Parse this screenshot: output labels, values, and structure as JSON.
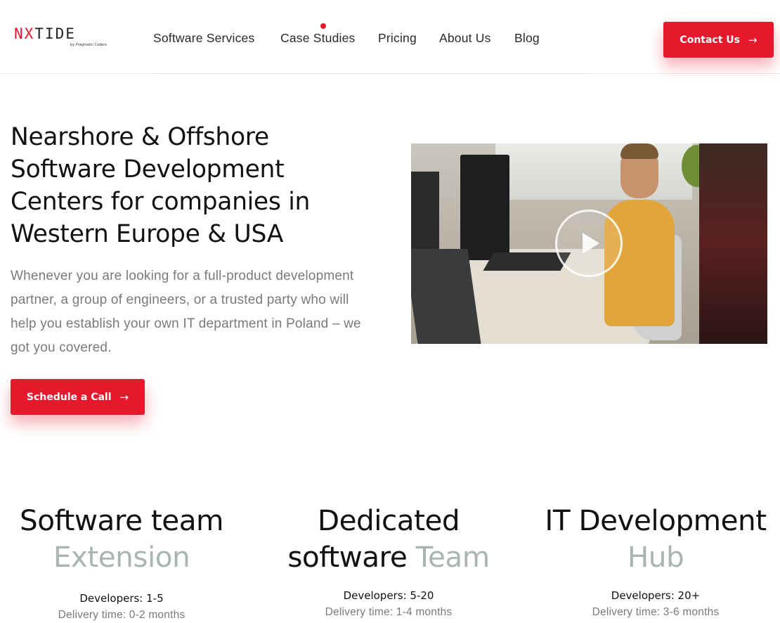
{
  "brand": {
    "logo_first": "N",
    "logo_x": "X",
    "logo_rest": "TIDE",
    "logo_sub": "by Pragmatic Coders",
    "accent": "#e5192b"
  },
  "nav": {
    "items": [
      "Software Services",
      "Case Studies",
      "Pricing",
      "About Us",
      "Blog"
    ]
  },
  "header": {
    "contact_label": "Contact Us",
    "arrow_icon": "arrow-right-icon"
  },
  "hero": {
    "title": "Nearshore & Offshore Software Development Centers for companies in Western Europe & USA",
    "text": "Whenever you are looking for a full-product development partner, a group of engineers, or a trusted party who will help you establish your own IT department in Poland – we got you covered.",
    "cta_label": "Schedule a Call",
    "video_icon": "play-icon"
  },
  "services": [
    {
      "title_a": "Software team",
      "title_b": "Extension",
      "title_c": "",
      "developers": "Developers: 1-5",
      "delivery": "Delivery time: 0-2 months"
    },
    {
      "title_a": "Dedicated",
      "title_b": "software",
      "title_c": "Team",
      "developers": "Developers: 5-20",
      "delivery": "Delivery time: 1-4 months"
    },
    {
      "title_a": "IT Development",
      "title_b": "Hub",
      "title_c": "",
      "developers": "Developers: 20+",
      "delivery": "Delivery time: 3-6 months"
    }
  ]
}
